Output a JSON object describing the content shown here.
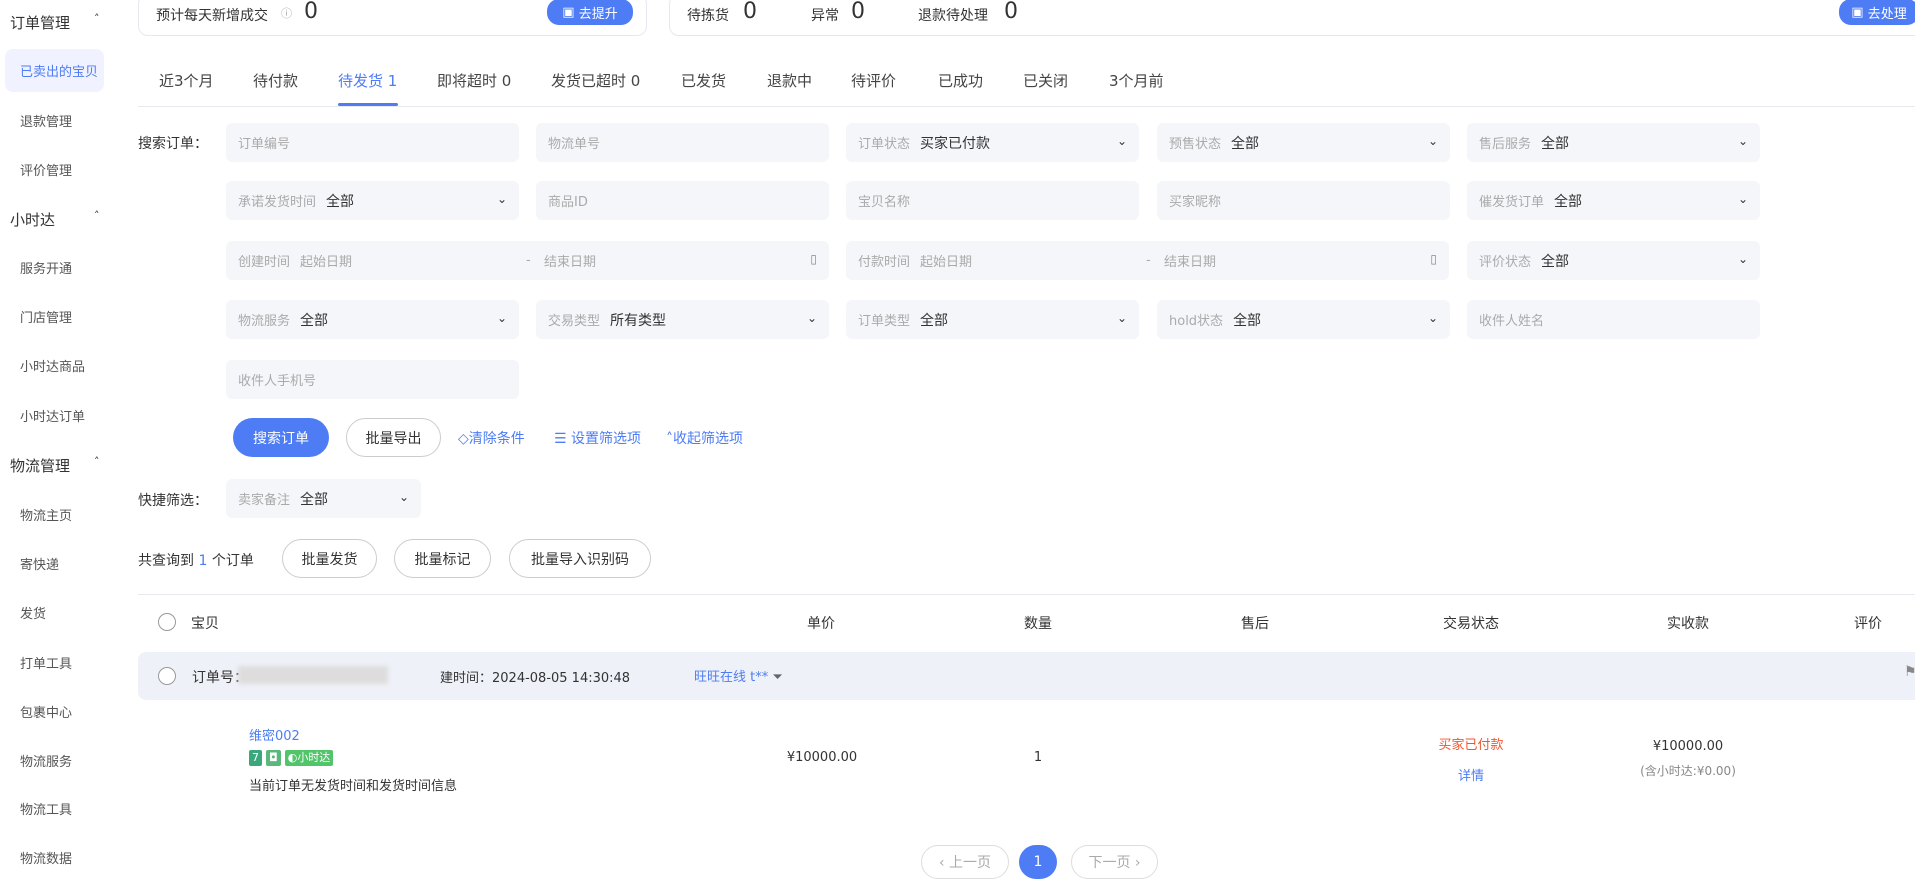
{
  "sidebar": {
    "groups": [
      {
        "title": "订单管理",
        "items": [
          "已卖出的宝贝",
          "退款管理",
          "评价管理"
        ]
      },
      {
        "title": "小时达",
        "items": [
          "服务开通",
          "门店管理",
          "小时达商品",
          "小时达订单"
        ]
      },
      {
        "title": "物流管理",
        "items": [
          "物流主页",
          "寄快递",
          "发货",
          "打单工具",
          "包裹中心",
          "物流服务",
          "物流工具",
          "物流数据"
        ]
      }
    ],
    "active": "已卖出的宝贝"
  },
  "top": {
    "card1": {
      "label": "预计每天新增成交",
      "value": "0",
      "button": "去提升"
    },
    "card2": {
      "stats": [
        {
          "label": "待拣货",
          "value": "0"
        },
        {
          "label": "异常",
          "value": "0"
        },
        {
          "label": "退款待处理",
          "value": "0"
        }
      ],
      "button": "去处理"
    }
  },
  "tabs": [
    "近3个月",
    "待付款",
    "待发货 1",
    "即将超时 0",
    "发货已超时 0",
    "已发货",
    "退款中",
    "待评价",
    "已成功",
    "已关闭",
    "3个月前"
  ],
  "active_tab": "待发货 1",
  "search": {
    "label": "搜索订单：",
    "fields": [
      {
        "ph": "订单编号"
      },
      {
        "ph": "物流单号"
      },
      {
        "ph": "订单状态",
        "val": "买家已付款",
        "select": true
      },
      {
        "ph": "预售状态",
        "val": "全部",
        "select": true
      },
      {
        "ph": "售后服务",
        "val": "全部",
        "select": true
      },
      {
        "ph": "承诺发货时间",
        "val": "全部",
        "select": true
      },
      {
        "ph": "商品ID"
      },
      {
        "ph": "宝贝名称"
      },
      {
        "ph": "买家昵称"
      },
      {
        "ph": "催发货订单",
        "val": "全部",
        "select": true
      },
      {
        "ph": "物流服务",
        "val": "全部",
        "select": true
      },
      {
        "ph": "交易类型",
        "val": "所有类型",
        "select": true
      },
      {
        "ph": "订单类型",
        "val": "全部",
        "select": true
      },
      {
        "ph": "hold状态",
        "val": "全部",
        "select": true
      },
      {
        "ph": "收件人姓名"
      },
      {
        "ph": "收件人手机号"
      }
    ],
    "dates": [
      {
        "ph": "创建时间",
        "start": "起始日期",
        "end": "结束日期"
      },
      {
        "ph": "付款时间",
        "start": "起始日期",
        "end": "结束日期"
      }
    ],
    "rating": {
      "ph": "评价状态",
      "val": "全部"
    },
    "search_btn": "搜索订单",
    "export_btn": "批量导出",
    "clear": "清除条件",
    "settings": "设置筛选项",
    "collapse": "收起筛选项"
  },
  "quick": {
    "label": "快捷筛选：",
    "ph": "卖家备注",
    "val": "全部"
  },
  "result": {
    "prefix": "共查询到",
    "count": "1",
    "suffix": "个订单",
    "buttons": [
      "批量发货",
      "批量标记",
      "批量导入识别码"
    ]
  },
  "table": {
    "headers": [
      "宝贝",
      "单价",
      "数量",
      "售后",
      "交易状态",
      "实收款",
      "评价"
    ],
    "order": {
      "no_label": "订单号：",
      "time": "建时间：2024-08-05 14:30:48",
      "wangwang": "旺旺在线 t**"
    },
    "item": {
      "name": "维密002",
      "badge": "小时达",
      "note": "当前订单无发货时间和发货时间信息",
      "price": "¥10000.00",
      "qty": "1",
      "status": "买家已付款",
      "detail": "详情",
      "paid": "¥10000.00",
      "paid_note": "(含小时达:¥0.00)"
    }
  },
  "pagination": {
    "prev": "‹ 上一页",
    "page": "1",
    "next": "下一页 ›"
  },
  "colors": {
    "accent": "#4d7cf5",
    "status": "#f2552c"
  }
}
